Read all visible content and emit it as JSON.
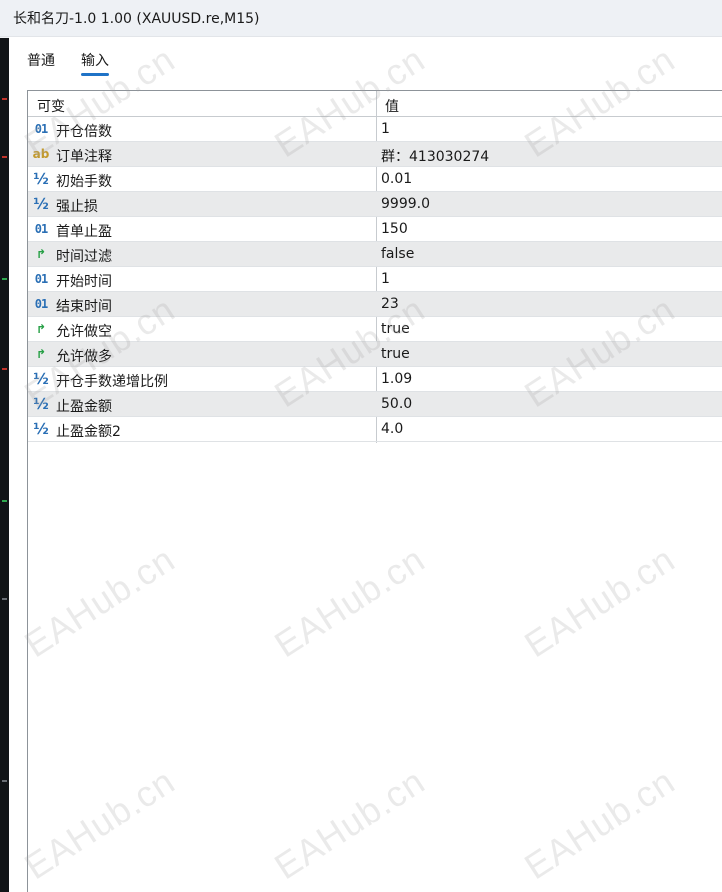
{
  "window": {
    "title": "长和名刀-1.0 1.00 (XAUUSD.re,M15)"
  },
  "tabs": [
    {
      "label": "普通",
      "active": false
    },
    {
      "label": "输入",
      "active": true
    }
  ],
  "table": {
    "headers": {
      "name": "可变",
      "value": "值"
    },
    "rows": [
      {
        "icon": "int-type-icon",
        "glyph": "01",
        "name": "开仓倍数",
        "value": "1"
      },
      {
        "icon": "string-type-icon",
        "glyph": "ab",
        "name": "订单注释",
        "value": "群：413030274"
      },
      {
        "icon": "double-type-icon",
        "glyph": "½",
        "name": "初始手数",
        "value": "0.01"
      },
      {
        "icon": "double-type-icon",
        "glyph": "½",
        "name": "强止损",
        "value": "9999.0"
      },
      {
        "icon": "int-type-icon",
        "glyph": "01",
        "name": "首单止盈",
        "value": "150"
      },
      {
        "icon": "bool-type-icon",
        "glyph": "↱",
        "name": "时间过滤",
        "value": "false"
      },
      {
        "icon": "int-type-icon",
        "glyph": "01",
        "name": "开始时间",
        "value": "1"
      },
      {
        "icon": "int-type-icon",
        "glyph": "01",
        "name": "结束时间",
        "value": "23"
      },
      {
        "icon": "bool-type-icon",
        "glyph": "↱",
        "name": "允许做空",
        "value": "true"
      },
      {
        "icon": "bool-type-icon",
        "glyph": "↱",
        "name": "允许做多",
        "value": "true"
      },
      {
        "icon": "double-type-icon",
        "glyph": "½",
        "name": "开仓手数递增比例",
        "value": "1.09"
      },
      {
        "icon": "double-type-icon",
        "glyph": "½",
        "name": "止盈金额",
        "value": "50.0"
      },
      {
        "icon": "double-type-icon",
        "glyph": "½",
        "name": "止盈金额2",
        "value": "4.0"
      }
    ]
  },
  "watermark": {
    "text": "EAHub.cn"
  },
  "colors": {
    "accent": "#1f73c7",
    "int_icon": "#2a6fb5",
    "string_icon": "#c39a2c",
    "bool_icon": "#27a046",
    "alt_row": "#e9eaeb"
  }
}
